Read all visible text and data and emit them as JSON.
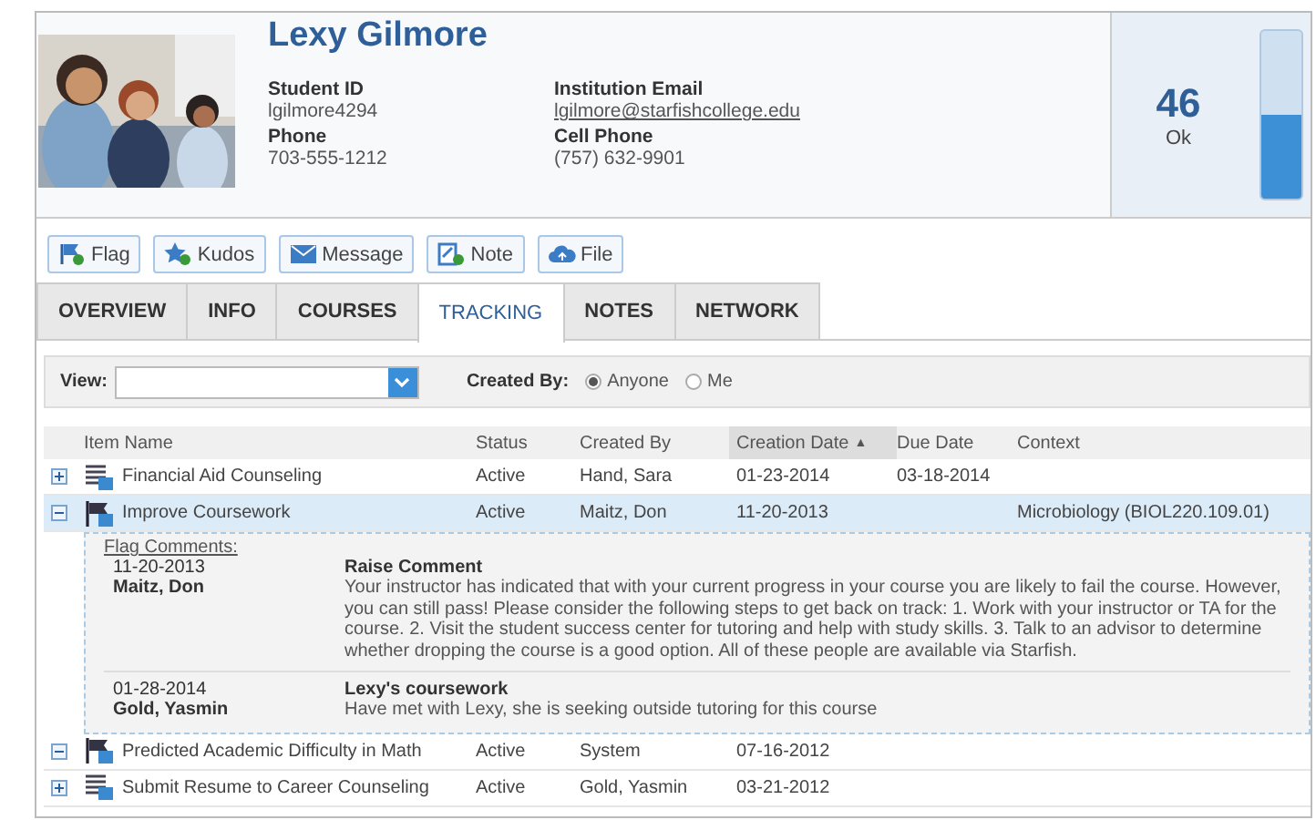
{
  "student": {
    "name": "Lexy Gilmore",
    "fields": [
      {
        "label": "Student ID",
        "value": "lgilmore4294",
        "kind": "text"
      },
      {
        "label": "Institution Email",
        "value": "lgilmore@starfishcollege.edu",
        "kind": "link"
      },
      {
        "label": "Phone",
        "value": "703-555-1212",
        "kind": "text"
      },
      {
        "label": "Cell Phone",
        "value": "(757) 632-9901",
        "kind": "text"
      }
    ],
    "score": {
      "value": "46",
      "label": "Ok",
      "level": 0.5
    }
  },
  "actions": [
    {
      "label": "Flag",
      "kind": "flag"
    },
    {
      "label": "Kudos",
      "kind": "kudos"
    },
    {
      "label": "Message",
      "kind": "message"
    },
    {
      "label": "Note",
      "kind": "note"
    },
    {
      "label": "File",
      "kind": "file"
    }
  ],
  "tabs": [
    {
      "label": "OVERVIEW",
      "selected": false
    },
    {
      "label": "INFO",
      "selected": false
    },
    {
      "label": "COURSES",
      "selected": false
    },
    {
      "label": "TRACKING",
      "selected": true
    },
    {
      "label": "NOTES",
      "selected": false
    },
    {
      "label": "NETWORK",
      "selected": false
    }
  ],
  "filter": {
    "view_label": "View:",
    "created_by_label": "Created By:",
    "options": [
      {
        "label": "Anyone",
        "selected": true
      },
      {
        "label": "Me",
        "selected": false
      }
    ]
  },
  "table": {
    "columns": [
      {
        "label": "Item Name",
        "sorted": false
      },
      {
        "label": "Status",
        "sorted": false
      },
      {
        "label": "Created By",
        "sorted": false
      },
      {
        "label": "Creation Date",
        "sorted": true,
        "sort_arrow": "▲"
      },
      {
        "label": "Due Date",
        "sorted": false
      },
      {
        "label": "Context",
        "sorted": false
      }
    ],
    "rows": [
      {
        "kind": "task",
        "expanded": false,
        "selected": false,
        "cells": [
          "Financial Aid Counseling",
          "Active",
          "Hand, Sara",
          "01-23-2014",
          "03-18-2014",
          ""
        ]
      },
      {
        "kind": "flag",
        "expanded": true,
        "selected": true,
        "cells": [
          "Improve Coursework",
          "Active",
          "Maitz, Don",
          "11-20-2013",
          "",
          "Microbiology (BIOL220.109.01)"
        ],
        "comments_title": "Flag Comments:",
        "comments": [
          {
            "date": "11-20-2013",
            "author": "Maitz, Don",
            "title": "Raise Comment",
            "text": "Your instructor has indicated that with your current progress in your course you are likely to fail the course. However, you can still pass! Please consider the following steps to get back on track: 1. Work with your instructor or TA for the course. 2. Visit the student success center for tutoring and help with study skills. 3. Talk to an advisor to determine whether dropping the course is a good option. All of these people are available via Starfish."
          },
          {
            "date": "01-28-2014",
            "author": "Gold, Yasmin",
            "title": "Lexy's coursework",
            "text": "Have met with Lexy, she is seeking outside tutoring for this course"
          }
        ]
      },
      {
        "kind": "flag",
        "expanded": true,
        "selected": false,
        "cells": [
          "Predicted Academic Difficulty in Math",
          "Active",
          "System",
          "07-16-2012",
          "",
          ""
        ]
      },
      {
        "kind": "task",
        "expanded": false,
        "selected": false,
        "cells": [
          "Submit Resume to Career Counseling",
          "Active",
          "Gold, Yasmin",
          "03-21-2012",
          "",
          ""
        ]
      }
    ]
  }
}
